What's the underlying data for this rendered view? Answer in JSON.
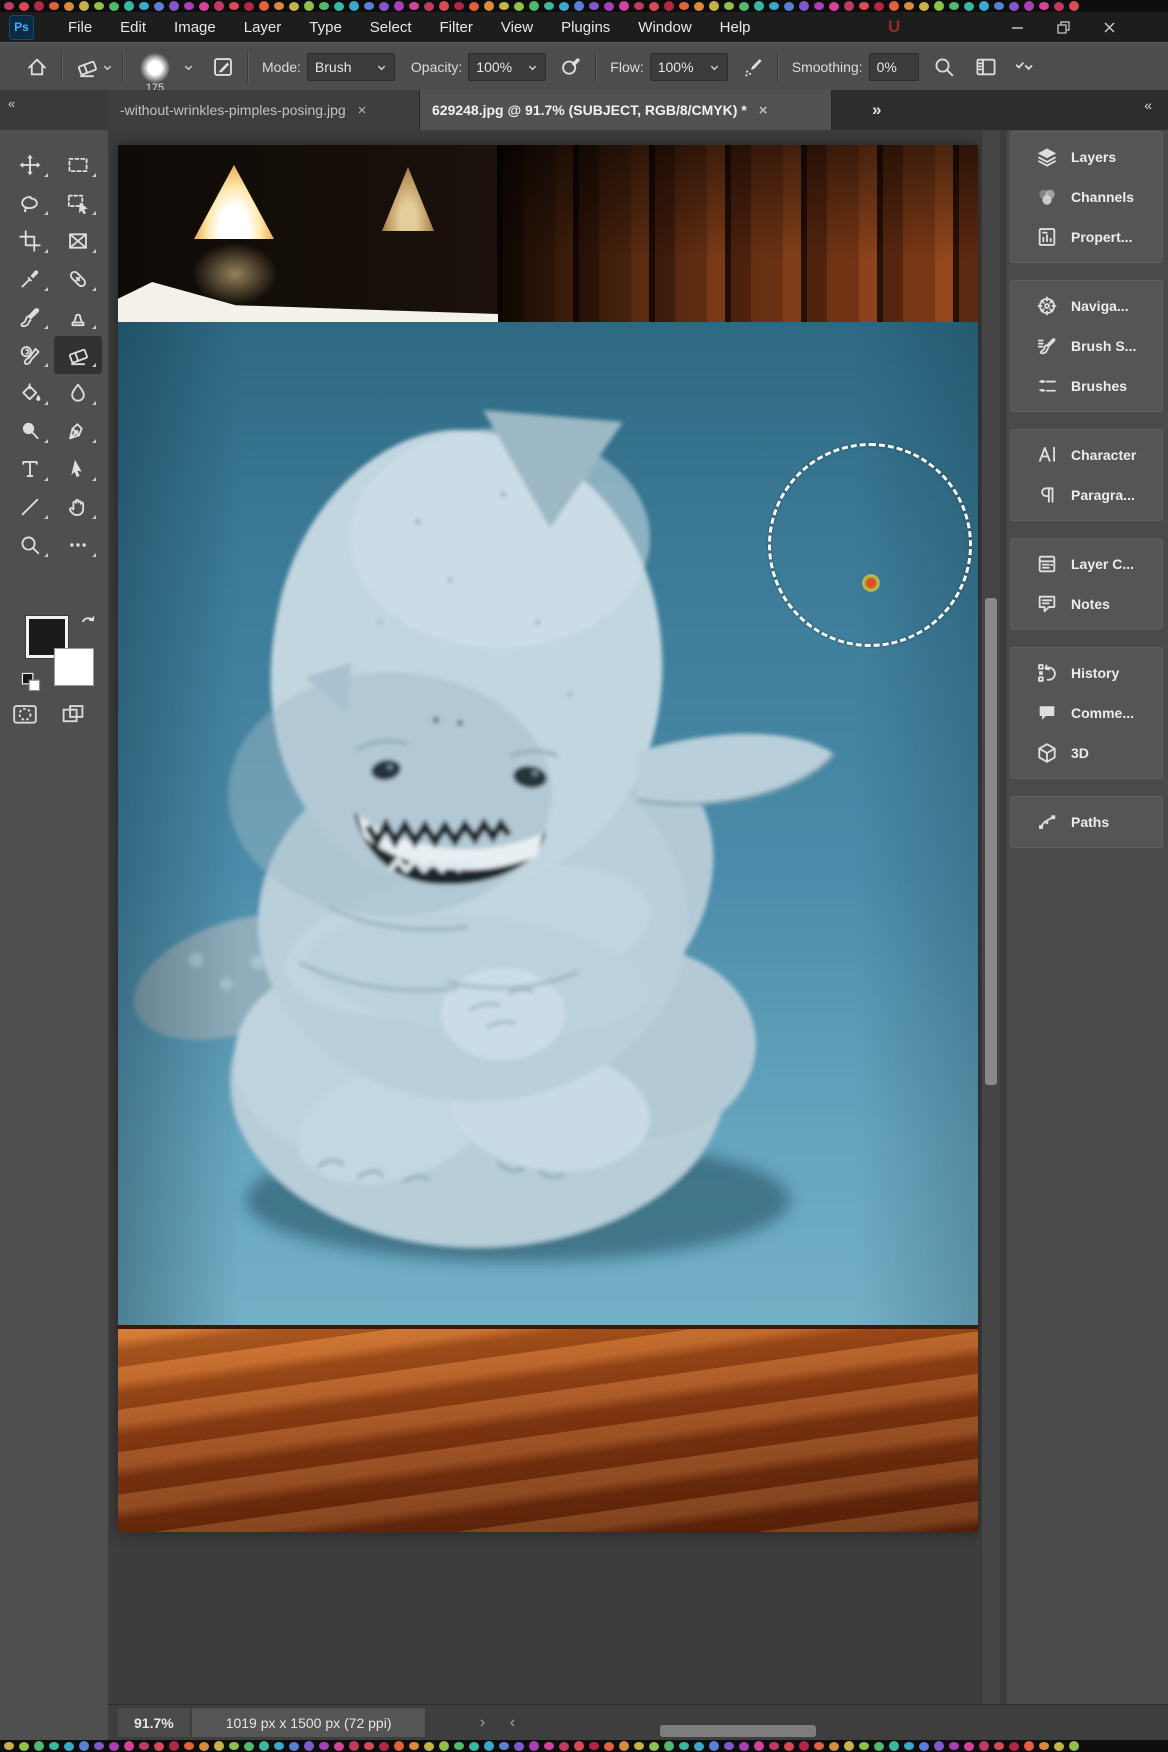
{
  "titlebar": {
    "logo": "Ps",
    "menus": [
      "File",
      "Edit",
      "Image",
      "Layer",
      "Type",
      "Select",
      "Filter",
      "View",
      "Plugins",
      "Window",
      "Help"
    ]
  },
  "options_bar": {
    "brush_size": "175",
    "mode_label": "Mode:",
    "mode_value": "Brush",
    "opacity_label": "Opacity:",
    "opacity_value": "100%",
    "flow_label": "Flow:",
    "flow_value": "100%",
    "smoothing_label": "Smoothing:",
    "smoothing_value": "0%"
  },
  "tab_bar": {
    "toolbar_collapse": "«",
    "panel_collapse": "«",
    "overflow": "»",
    "tabs": [
      {
        "label": "-without-wrinkles-pimples-posing.jpg",
        "close": "×",
        "active": false
      },
      {
        "label": "629248.jpg @ 91.7% (SUBJECT, RGB/8/CMYK) *",
        "close": "×",
        "active": true
      }
    ]
  },
  "toolbar": {
    "tools": [
      {
        "icon": "move-icon",
        "name": "move-tool",
        "selected": false
      },
      {
        "icon": "rect-marquee-icon",
        "name": "rectangular-marquee-tool",
        "selected": false
      },
      {
        "icon": "lasso-icon",
        "name": "lasso-tool",
        "selected": false
      },
      {
        "icon": "object-selection-icon",
        "name": "object-selection-tool",
        "selected": false
      },
      {
        "icon": "crop-icon",
        "name": "crop-tool",
        "selected": false
      },
      {
        "icon": "frame-icon",
        "name": "frame-tool",
        "selected": false
      },
      {
        "icon": "eyedropper-icon",
        "name": "eyedropper-tool",
        "selected": false
      },
      {
        "icon": "healing-brush-icon",
        "name": "healing-brush-tool",
        "selected": false
      },
      {
        "icon": "brush-icon",
        "name": "brush-tool",
        "selected": false
      },
      {
        "icon": "clone-stamp-icon",
        "name": "clone-stamp-tool",
        "selected": false
      },
      {
        "icon": "history-brush-icon",
        "name": "history-brush-tool",
        "selected": false
      },
      {
        "icon": "eraser-icon",
        "name": "eraser-tool",
        "selected": true
      },
      {
        "icon": "paint-bucket-icon",
        "name": "gradient-bucket-tool",
        "selected": false
      },
      {
        "icon": "blur-icon",
        "name": "blur-tool",
        "selected": false
      },
      {
        "icon": "dodge-icon",
        "name": "dodge-tool",
        "selected": false
      },
      {
        "icon": "pen-icon",
        "name": "pen-tool",
        "selected": false
      },
      {
        "icon": "type-icon",
        "name": "type-tool",
        "selected": false
      },
      {
        "icon": "path-select-icon",
        "name": "path-selection-tool",
        "selected": false
      },
      {
        "icon": "line-icon",
        "name": "line-tool",
        "selected": false
      },
      {
        "icon": "hand-icon",
        "name": "hand-tool",
        "selected": false
      },
      {
        "icon": "zoom-icon",
        "name": "zoom-tool",
        "selected": false
      },
      {
        "icon": "more-tools-icon",
        "name": "edit-toolbar-button",
        "selected": false
      }
    ],
    "foreground_color": "#1b1b1b",
    "background_color": "#ffffff"
  },
  "panel": {
    "groups": [
      [
        {
          "icon": "layers-icon",
          "label": "Layers"
        },
        {
          "icon": "channels-icon",
          "label": "Channels"
        },
        {
          "icon": "properties-icon",
          "label": "Propert..."
        }
      ],
      [
        {
          "icon": "navigator-icon",
          "label": "Naviga..."
        },
        {
          "icon": "brush-settings-icon",
          "label": "Brush S..."
        },
        {
          "icon": "brushes-icon",
          "label": "Brushes"
        }
      ],
      [
        {
          "icon": "character-icon",
          "label": "Character"
        },
        {
          "icon": "paragraph-icon",
          "label": "Paragra..."
        }
      ],
      [
        {
          "icon": "layer-comps-icon",
          "label": "Layer C..."
        },
        {
          "icon": "notes-icon",
          "label": "Notes"
        }
      ],
      [
        {
          "icon": "history-icon",
          "label": "History"
        },
        {
          "icon": "comments-icon",
          "label": "Comme..."
        },
        {
          "icon": "cube-3d-icon",
          "label": "3D"
        }
      ],
      [
        {
          "icon": "paths-icon",
          "label": "Paths"
        }
      ]
    ]
  },
  "status_bar": {
    "zoom": "91.7%",
    "dimensions": "1019 px x 1500 px (72 ppi)"
  },
  "canvas_image": {
    "description": "pale blue baby shark creature sitting cross-legged on teal floor, warm wood-panel room with hanging lamps above, orange wood table edge below",
    "wall_color": "#4c8caa",
    "creature_color": "#bdd2dc",
    "wood_color": "#8e3c12"
  }
}
